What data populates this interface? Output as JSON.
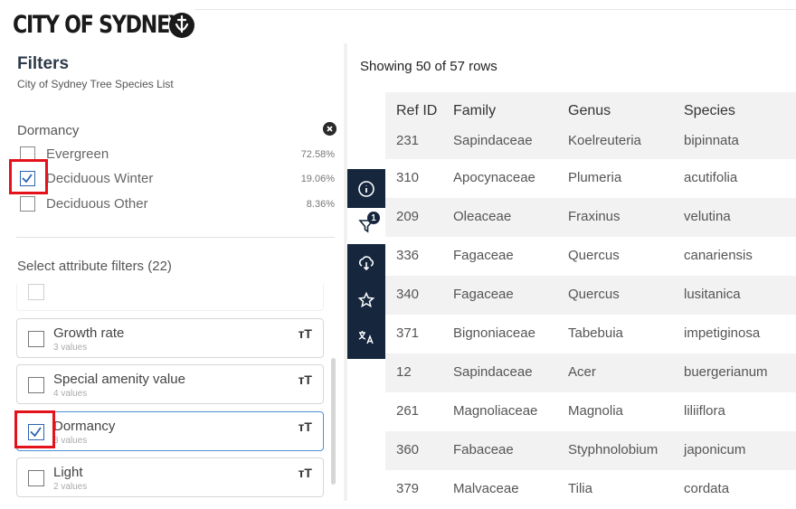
{
  "brand": {
    "logo_text": "CITY OF SYDNEY"
  },
  "filters": {
    "title": "Filters",
    "subtitle": "City of Sydney Tree Species List",
    "dormancy": {
      "title": "Dormancy",
      "options": [
        {
          "label": "Evergreen",
          "percent": "72.58%",
          "checked": false
        },
        {
          "label": "Deciduous Winter",
          "percent": "19.06%",
          "checked": true
        },
        {
          "label": "Deciduous Other",
          "percent": "8.36%",
          "checked": false
        }
      ]
    },
    "attr_title": "Select attribute filters (22)",
    "attributes": [
      {
        "name": "Growth rate",
        "count": "3 values",
        "checked": false
      },
      {
        "name": "Special amenity value",
        "count": "4 values",
        "checked": false
      },
      {
        "name": "Dormancy",
        "count": "3 values",
        "checked": true
      },
      {
        "name": "Light",
        "count": "2 values",
        "checked": false
      }
    ],
    "type_icon": "ᴛT"
  },
  "toolbar": {
    "icons": [
      "info-icon",
      "filter-icon",
      "cloud-download-icon",
      "star-icon",
      "translate-icon"
    ],
    "filter_badge": "1"
  },
  "table": {
    "showing": "Showing 50 of 57 rows",
    "columns": [
      "Ref ID",
      "Family",
      "Genus",
      "Species"
    ],
    "rows": [
      [
        "231",
        "Sapindaceae",
        "Koelreuteria",
        "bipinnata"
      ],
      [
        "310",
        "Apocynaceae",
        "Plumeria",
        "acutifolia"
      ],
      [
        "209",
        "Oleaceae",
        "Fraxinus",
        "velutina"
      ],
      [
        "336",
        "Fagaceae",
        "Quercus",
        "canariensis"
      ],
      [
        "340",
        "Fagaceae",
        "Quercus",
        "lusitanica"
      ],
      [
        "371",
        "Bignoniaceae",
        "Tabebuia",
        "impetiginosa"
      ],
      [
        "12",
        "Sapindaceae",
        "Acer",
        "buergerianum"
      ],
      [
        "261",
        "Magnoliaceae",
        "Magnolia",
        "liliiflora"
      ],
      [
        "360",
        "Fabaceae",
        "Styphnolobium",
        "japonicum"
      ],
      [
        "379",
        "Malvaceae",
        "Tilia",
        "cordata"
      ]
    ]
  },
  "colors": {
    "highlight": "#e3121b",
    "toolbar": "#15263d",
    "check": "#2b63b0"
  }
}
